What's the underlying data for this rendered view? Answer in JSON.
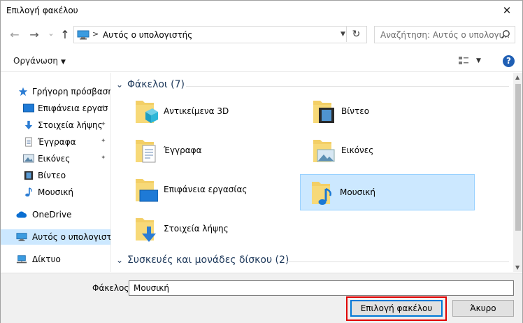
{
  "window": {
    "title": "Επιλογή φακέλου",
    "close_glyph": "✕"
  },
  "nav": {
    "back_glyph": "←",
    "forward_glyph": "→",
    "recent_glyph": "⌄",
    "up_glyph": "↑",
    "address_separator": ">",
    "address_text": "Αυτός ο υπολογιστής",
    "refresh_glyph": "↻",
    "search_placeholder": "Αναζήτηση: Αυτός ο υπολογι..."
  },
  "toolbar": {
    "organize_label": "Οργάνωση",
    "help_glyph": "?"
  },
  "sidebar": {
    "items": [
      {
        "label": "Γρήγορη πρόσβαση",
        "icon": "star-icon"
      },
      {
        "label": "Επιφάνεια εργασ",
        "icon": "desktop-icon",
        "pinned": true
      },
      {
        "label": "Στοιχεία λήψης",
        "icon": "download-icon",
        "pinned": true
      },
      {
        "label": "Έγγραφα",
        "icon": "documents-icon",
        "pinned": true
      },
      {
        "label": "Εικόνες",
        "icon": "pictures-icon",
        "pinned": true
      },
      {
        "label": "Βίντεο",
        "icon": "video-icon"
      },
      {
        "label": "Μουσική",
        "icon": "music-icon"
      },
      {
        "label": "OneDrive",
        "icon": "cloud-icon"
      },
      {
        "label": "Αυτός ο υπολογιστ",
        "icon": "computer-icon",
        "selected": true
      },
      {
        "label": "Δίκτυο",
        "icon": "network-icon"
      }
    ],
    "pin_glyph": "📌"
  },
  "main": {
    "folders_group": "Φάκελοι (7)",
    "folders": [
      {
        "label": "Αντικείμενα 3D",
        "icon": "objects-3d-folder-icon"
      },
      {
        "label": "Βίντεο",
        "icon": "videos-folder-icon"
      },
      {
        "label": "Έγγραφα",
        "icon": "documents-folder-icon"
      },
      {
        "label": "Εικόνες",
        "icon": "pictures-folder-icon"
      },
      {
        "label": "Επιφάνεια εργασίας",
        "icon": "desktop-folder-icon"
      },
      {
        "label": "Μουσική",
        "icon": "music-folder-icon",
        "selected": true
      },
      {
        "label": "Στοιχεία λήψης",
        "icon": "downloads-folder-icon"
      }
    ],
    "devices_group": "Συσκευές και μονάδες δίσκου (2)"
  },
  "bottom": {
    "folder_label": "Φάκελος:",
    "folder_value": "Μουσική",
    "select_button": "Επιλογή φακέλου",
    "cancel_button": "Άκυρο"
  },
  "colors": {
    "accent": "#0078d7",
    "selection": "#cce8ff",
    "highlight_box": "#e00000",
    "group_header": "#1e395b"
  }
}
